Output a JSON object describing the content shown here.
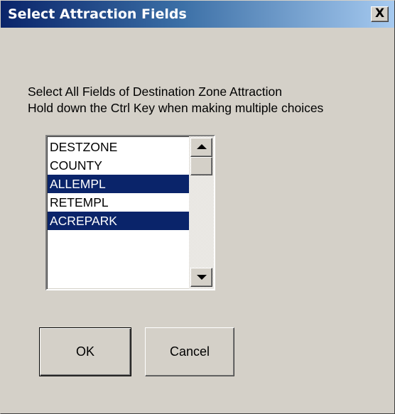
{
  "window": {
    "title": "Select Attraction Fields",
    "close_label": "X"
  },
  "instructions": {
    "line1": "Select All Fields of Destination Zone Attraction",
    "line2": "Hold down the Ctrl Key when making multiple choices"
  },
  "fields_list": {
    "items": [
      {
        "label": "DESTZONE",
        "selected": false
      },
      {
        "label": "COUNTY",
        "selected": false
      },
      {
        "label": "ALLEMPL",
        "selected": true
      },
      {
        "label": "RETEMPL",
        "selected": false
      },
      {
        "label": "ACREPARK",
        "selected": true
      }
    ]
  },
  "buttons": {
    "ok_label": "OK",
    "cancel_label": "Cancel"
  },
  "colors": {
    "title_bar_start": "#0a246a",
    "title_bar_end": "#a6caf0",
    "dialog_face": "#d4d0c8",
    "selection_bg": "#0a246a",
    "selection_text": "#ffffff"
  },
  "icons": {
    "close": "close-icon",
    "scroll_up": "arrow-up-icon",
    "scroll_down": "arrow-down-icon"
  }
}
